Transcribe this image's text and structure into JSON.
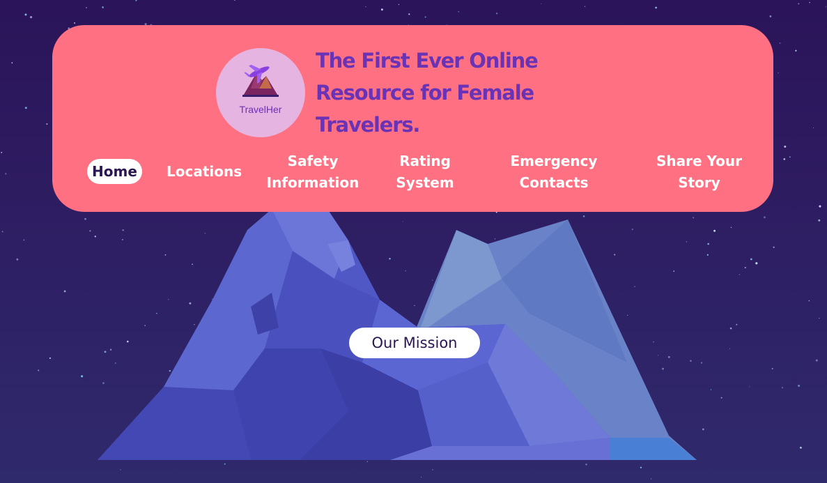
{
  "brand": {
    "logo_text": "TravelHer",
    "tagline": "The First Ever Online Resource for Female Travelers."
  },
  "nav": {
    "items": [
      {
        "label": "Home",
        "active": true
      },
      {
        "label": "Locations"
      },
      {
        "label": "Safety Information"
      },
      {
        "label": "Rating System"
      },
      {
        "label": "Emergency Contacts"
      },
      {
        "label": "Share Your Story"
      }
    ]
  },
  "hero": {
    "cta_label": "Our Mission"
  },
  "colors": {
    "background": "#2b1459",
    "header_card": "#ff7182",
    "tagline": "#6a33b5",
    "logo_bg": "#e6b4e0",
    "nav_text": "#ffffff",
    "active_pill": "#ffffff",
    "mountain_main": "#5058c6",
    "mountain_back": "#7590cc"
  },
  "icons": {
    "logo": "airplane-mountain-icon"
  }
}
